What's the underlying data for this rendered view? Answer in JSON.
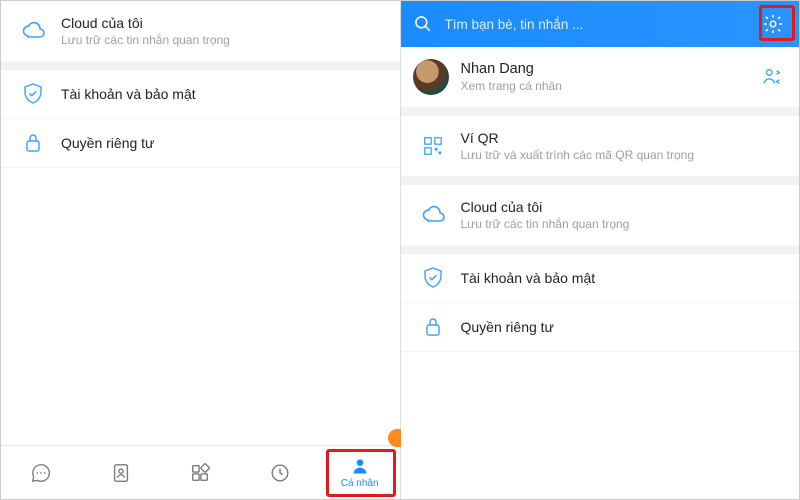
{
  "left": {
    "cloud": {
      "title": "Cloud của tôi",
      "sub": "Lưu trữ các tin nhắn quan trọng"
    },
    "account": {
      "title": "Tài khoản và bảo mật"
    },
    "privacy": {
      "title": "Quyền riêng tư"
    },
    "tabs": {
      "personal": "Cá nhân"
    }
  },
  "right": {
    "search_placeholder": "Tìm bạn bè, tin nhắn ...",
    "profile": {
      "name": "Nhan Dang",
      "sub": "Xem trang cá nhân"
    },
    "qr": {
      "title": "Ví QR",
      "sub": "Lưu trữ và xuất trình các mã QR quan trọng"
    },
    "cloud": {
      "title": "Cloud của tôi",
      "sub": "Lưu trữ các tin nhắn quan trọng"
    },
    "account": {
      "title": "Tài khoản và bảo mật"
    },
    "privacy": {
      "title": "Quyền riêng tư"
    }
  },
  "colors": {
    "accent": "#1a8cff",
    "highlight": "#e11b1b"
  }
}
